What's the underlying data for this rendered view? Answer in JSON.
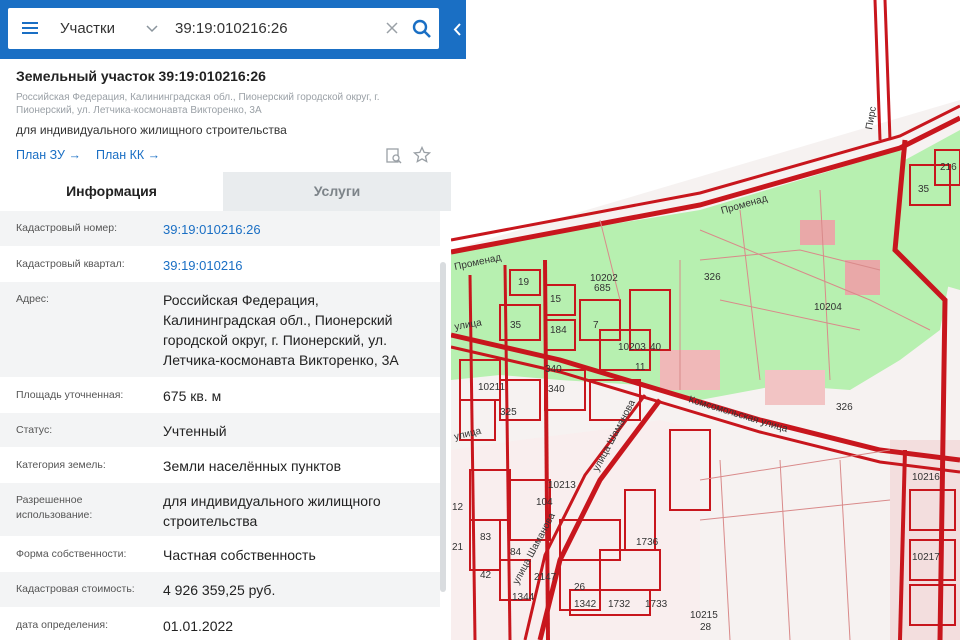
{
  "search": {
    "type_label": "Участки",
    "query": "39:19:010216:26"
  },
  "parcel": {
    "title": "Земельный участок 39:19:010216:26",
    "address": "Российская Федерация, Калининградская обл., Пионерский городской округ, г. Пионерский, ул. Летчика-космонавта Викторенко, 3А",
    "purpose": "для индивидуального жилищного строительства",
    "links": [
      "План ЗУ",
      "План КК"
    ]
  },
  "tabs": {
    "info": "Информация",
    "services": "Услуги"
  },
  "details": [
    {
      "label": "Кадастровый номер:",
      "value": "39:19:010216:26",
      "link": true
    },
    {
      "label": "Кадастровый квартал:",
      "value": "39:19:010216",
      "link": true
    },
    {
      "label": "Адрес:",
      "value": "Российская Федерация, Калининградская обл., Пионерский городской округ, г. Пионерский, ул. Летчика-космонавта Викторенко, 3А",
      "link": false
    },
    {
      "label": "Площадь уточненная:",
      "value": "675 кв. м",
      "link": false
    },
    {
      "label": "Статус:",
      "value": "Учтенный",
      "link": false
    },
    {
      "label": "Категория земель:",
      "value": "Земли населённых пунктов",
      "link": false
    },
    {
      "label": "Разрешенное использование:",
      "value": "для индивидуального жилищного строительства",
      "link": false
    },
    {
      "label": "Форма собственности:",
      "value": "Частная собственность",
      "link": false
    },
    {
      "label": "Кадастровая стоимость:",
      "value": "4 926 359,25 руб.",
      "link": false
    },
    {
      "label": "дата определения:",
      "value": "01.01.2022",
      "link": false
    }
  ],
  "map": {
    "labels": [
      "Променад",
      "Променад",
      "Комсомольская улица",
      "улица Шаманова",
      "улица Шаманова",
      "улица",
      "улица",
      "Пирс",
      "10202",
      "685",
      "10203",
      "10204",
      "10211",
      "10213",
      "10215",
      "10216",
      "10217",
      "19",
      "15",
      "184",
      "7",
      "35",
      "340",
      "340",
      "325",
      "326",
      "326",
      "40",
      "11",
      "35",
      "216",
      "104",
      "1736",
      "1342",
      "1732",
      "1733",
      "26",
      "2147",
      "1344",
      "42",
      "28",
      "83",
      "84",
      "12",
      "21"
    ]
  },
  "colors": {
    "accent": "#1a6fc4",
    "parcel_fill": "#b7f0b0",
    "boundary": "#c8161d"
  }
}
